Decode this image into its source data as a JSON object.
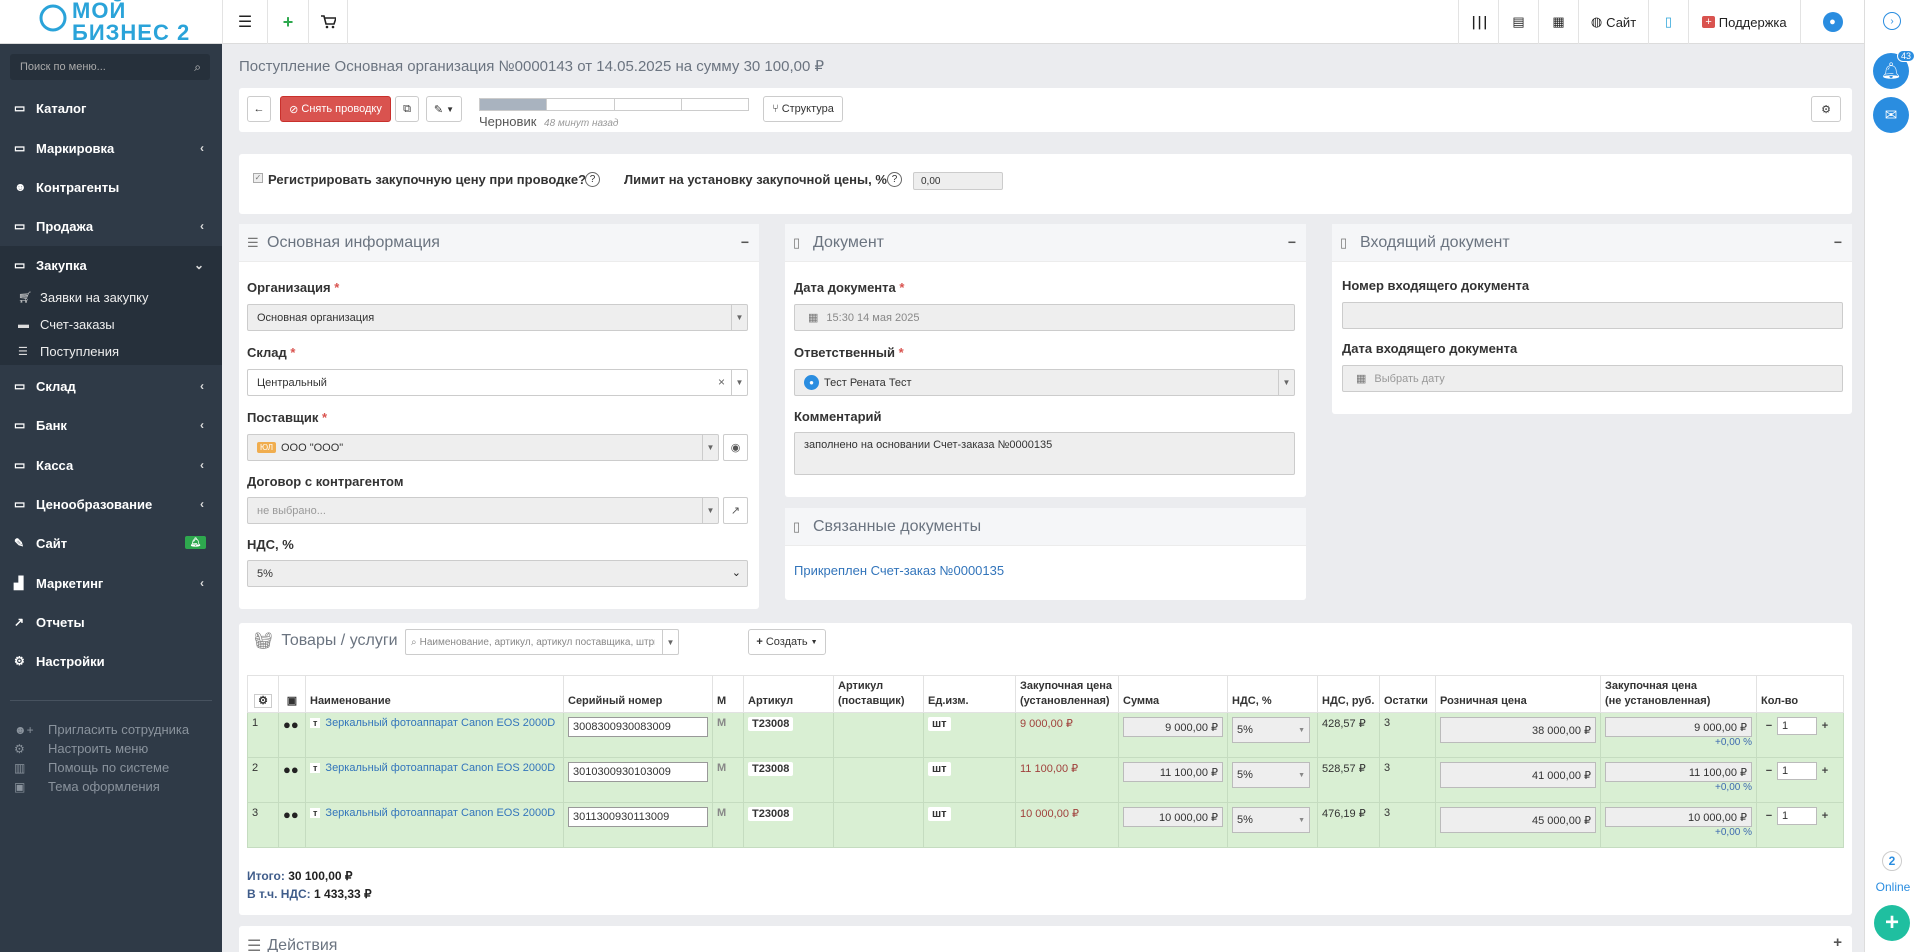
{
  "header": {
    "logo": "МОЙ БИЗНЕС 2",
    "site_label": "Сайт",
    "support_label": "Поддержка"
  },
  "sidebar": {
    "search_placeholder": "Поиск по меню...",
    "items": [
      {
        "label": "Каталог"
      },
      {
        "label": "Маркировка"
      },
      {
        "label": "Контрагенты"
      },
      {
        "label": "Продажа"
      },
      {
        "label": "Закупка"
      },
      {
        "label": "Склад"
      },
      {
        "label": "Банк"
      },
      {
        "label": "Касса"
      },
      {
        "label": "Ценообразование"
      },
      {
        "label": "Сайт"
      },
      {
        "label": "Маркетинг"
      },
      {
        "label": "Отчеты"
      },
      {
        "label": "Настройки"
      }
    ],
    "subitems": [
      {
        "label": "Заявки на закупку"
      },
      {
        "label": "Счет-заказы"
      },
      {
        "label": "Поступления"
      }
    ],
    "footer": [
      {
        "label": "Пригласить сотрудника"
      },
      {
        "label": "Настроить меню"
      },
      {
        "label": "Помощь по системе"
      },
      {
        "label": "Тема оформления"
      }
    ]
  },
  "page": {
    "title": "Поступление Основная организация №0000143 от 14.05.2025 на сумму 30 100,00 ₽"
  },
  "toolbar": {
    "unpost_label": "Снять проводку",
    "status_label": "Черновик",
    "status_time": "48 минут назад",
    "structure_label": "Структура",
    "progress_fraction": 0.25
  },
  "register": {
    "checkbox_label": "Регистрировать закупочную цену при проводке?",
    "limit_label": "Лимит на установку закупочной цены, %",
    "limit_value": "0,00"
  },
  "main_info": {
    "title": "Основная информация",
    "org_label": "Организация",
    "org_value": "Основная организация",
    "warehouse_label": "Склад",
    "warehouse_value": "Центральный",
    "supplier_label": "Поставщик",
    "supplier_badge": "ЮЛ",
    "supplier_value": "ООО \"ООО\"",
    "contract_label": "Договор с контрагентом",
    "contract_placeholder": "не выбрано...",
    "vat_label": "НДС, %",
    "vat_value": "5%"
  },
  "document": {
    "title": "Документ",
    "date_label": "Дата документа",
    "date_value": "15:30 14 мая 2025",
    "responsible_label": "Ответственный",
    "responsible_value": "Тест Рената Тест",
    "comment_label": "Комментарий",
    "comment_value": "заполнено на основании Счет-заказа №0000135"
  },
  "linked": {
    "title": "Связанные документы",
    "link_text": "Прикреплен Счет-заказ №0000135"
  },
  "incoming": {
    "title": "Входящий документ",
    "number_label": "Номер входящего документа",
    "date_label": "Дата входящего документа",
    "date_placeholder": "Выбрать дату"
  },
  "goods": {
    "title": "Товары / услуги",
    "search_placeholder": "Наименование, артикул, артикул поставщика, штрихкод...",
    "create_label": "Создать",
    "columns": {
      "name": "Наименование",
      "serial": "Серийный номер",
      "m": "М",
      "article": "Артикул",
      "article_supplier_1": "Артикул",
      "article_supplier_2": "(поставщик)",
      "unit": "Ед.изм.",
      "purchase_set_1": "Закупочная цена",
      "purchase_set_2": "(установленная)",
      "sum": "Сумма",
      "vat": "НДС, %",
      "vat_rub": "НДС, руб.",
      "stock": "Остатки",
      "retail": "Розничная цена",
      "purchase_unset_1": "Закупочная цена",
      "purchase_unset_2": "(не установленная)",
      "qty": "Кол-во"
    },
    "rows": [
      {
        "num": "1",
        "type": "т",
        "name": "Зеркальный фотоаппарат Canon EOS 2000D",
        "serial": "3008300930083009",
        "m": "М",
        "article": "T23008",
        "unit": "шт",
        "purchase": "9 000,00 ₽",
        "sum": "9 000,00 ₽",
        "vat": "5%",
        "vat_rub": "428,57 ₽",
        "stock": "3",
        "retail": "38 000,00 ₽",
        "purchase_unset": "9 000,00 ₽",
        "markup": "+0,00 %",
        "qty": "1"
      },
      {
        "num": "2",
        "type": "т",
        "name": "Зеркальный фотоаппарат Canon EOS 2000D",
        "serial": "3010300930103009",
        "m": "М",
        "article": "T23008",
        "unit": "шт",
        "purchase": "11 100,00 ₽",
        "sum": "11 100,00 ₽",
        "vat": "5%",
        "vat_rub": "528,57 ₽",
        "stock": "3",
        "retail": "41 000,00 ₽",
        "purchase_unset": "11 100,00 ₽",
        "markup": "+0,00 %",
        "qty": "1"
      },
      {
        "num": "3",
        "type": "т",
        "name": "Зеркальный фотоаппарат Canon EOS 2000D",
        "serial": "3011300930113009",
        "m": "М",
        "article": "T23008",
        "unit": "шт",
        "purchase": "10 000,00 ₽",
        "sum": "10 000,00 ₽",
        "vat": "5%",
        "vat_rub": "476,19 ₽",
        "stock": "3",
        "retail": "45 000,00 ₽",
        "purchase_unset": "10 000,00 ₽",
        "markup": "+0,00 %",
        "qty": "1"
      }
    ],
    "total_label": "Итого:",
    "total_value": "30 100,00 ₽",
    "vat_total_label": "В т.ч. НДС:",
    "vat_total_value": "1 433,33 ₽"
  },
  "actions": {
    "title": "Действия"
  },
  "rightbar": {
    "notif_count": "43",
    "online_count": "2",
    "online_label": "Online"
  }
}
